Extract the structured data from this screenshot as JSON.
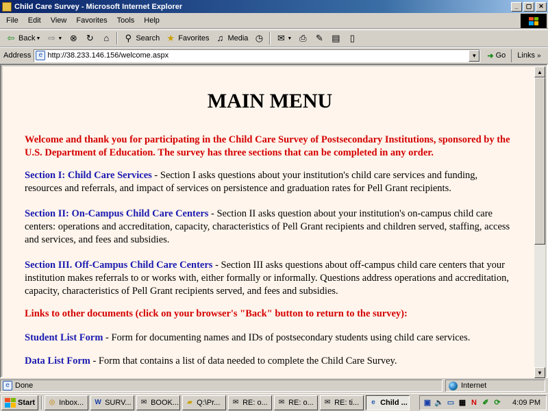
{
  "window": {
    "title": "Child Care Survey - Microsoft Internet Explorer",
    "buttons": [
      "_",
      "▢",
      "✕"
    ]
  },
  "menu": [
    "File",
    "Edit",
    "View",
    "Favorites",
    "Tools",
    "Help"
  ],
  "toolbar": {
    "back_label": "Back",
    "search_label": "Search",
    "favorites_label": "Favorites",
    "media_label": "Media"
  },
  "address": {
    "label": "Address",
    "url": "http://38.233.146.156/welcome.aspx",
    "go_label": "Go",
    "links_label": "Links"
  },
  "page": {
    "title": "MAIN MENU",
    "welcome": "Welcome and thank you for participating in the Child Care Survey of Postsecondary Institutions, sponsored by the U.S. Department of Education. The survey has three sections that can be completed in any order.",
    "sections": [
      {
        "link": "Section I: Child Care Services",
        "text": " - Section I asks questions about your institution's child care services and funding, resources and referrals, and impact of services on persistence and graduation rates for Pell Grant recipients."
      },
      {
        "link": "Section II: On-Campus Child Care Centers",
        "text": " - Section II asks question about your institution's on-campus child care centers: operations and accreditation, capacity, characteristics of Pell Grant recipients and children served, staffing, access and services, and fees and subsidies."
      },
      {
        "link": "Section III. Off-Campus Child Care Centers",
        "text": " - Section III asks questions about off-campus child care centers that your institution makes referrals to or works with, either formally or informally. Questions address operations and accreditation, capacity, characteristics of Pell Grant recipients served, and fees and subsidies."
      }
    ],
    "links_heading": "Links to other documents (click on your browser's \"Back\" button to return to the survey):",
    "documents": [
      {
        "link": "Student List Form",
        "text": " - Form for documenting names and IDs of postsecondary students using child care services."
      },
      {
        "link": "Data List Form",
        "text": " - Form that contains a list of data needed to complete the Child Care Survey."
      }
    ]
  },
  "status": {
    "left": "Done",
    "zone": "Internet"
  },
  "taskbar": {
    "start_label": "Start",
    "tasks": [
      {
        "label": "Inbox...",
        "icon": "inbox-icon"
      },
      {
        "label": "SURV...",
        "icon": "word-document-icon"
      },
      {
        "label": "BOOK...",
        "icon": "envelope-icon"
      },
      {
        "label": "Q:\\Pr...",
        "icon": "folder-icon"
      },
      {
        "label": "RE: o...",
        "icon": "envelope-icon"
      },
      {
        "label": "RE: o...",
        "icon": "envelope-icon"
      },
      {
        "label": "RE: ti...",
        "icon": "envelope-icon"
      },
      {
        "label": "Child ...",
        "icon": "ie-page-icon"
      }
    ],
    "active_task_index": 7,
    "clock": "4:09 PM"
  },
  "colors": {
    "title_bar": "#0a246a",
    "page_background": "#fff5ec",
    "welcome_red": "#d40000",
    "link_blue": "#1a1ab0",
    "chrome_gray": "#d4d0c8"
  }
}
